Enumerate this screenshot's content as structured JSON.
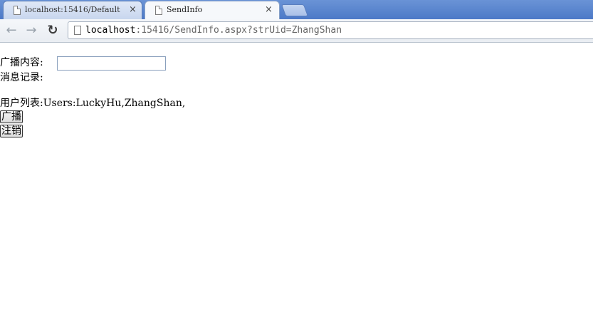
{
  "browser": {
    "tabs": [
      {
        "title": "localhost:15416/Default",
        "close": "×"
      },
      {
        "title": "SendInfo",
        "close": "×"
      }
    ],
    "nav": {
      "back": "←",
      "forward": "→",
      "reload": "↻"
    },
    "address": {
      "host": "localhost",
      "rest": ":15416/SendInfo.aspx?strUid=ZhangShan"
    }
  },
  "form": {
    "broadcast_label": "广播内容:",
    "broadcast_value": "",
    "message_log_label": "消息记录:",
    "user_list_label": "用户列表:",
    "user_list_value": "Users:LuckyHu,ZhangShan,",
    "broadcast_button": "广播",
    "logout_button": "注销"
  },
  "colors": {
    "tabstrip": "#4c79c7",
    "active_tab": "#f6f8fb"
  }
}
